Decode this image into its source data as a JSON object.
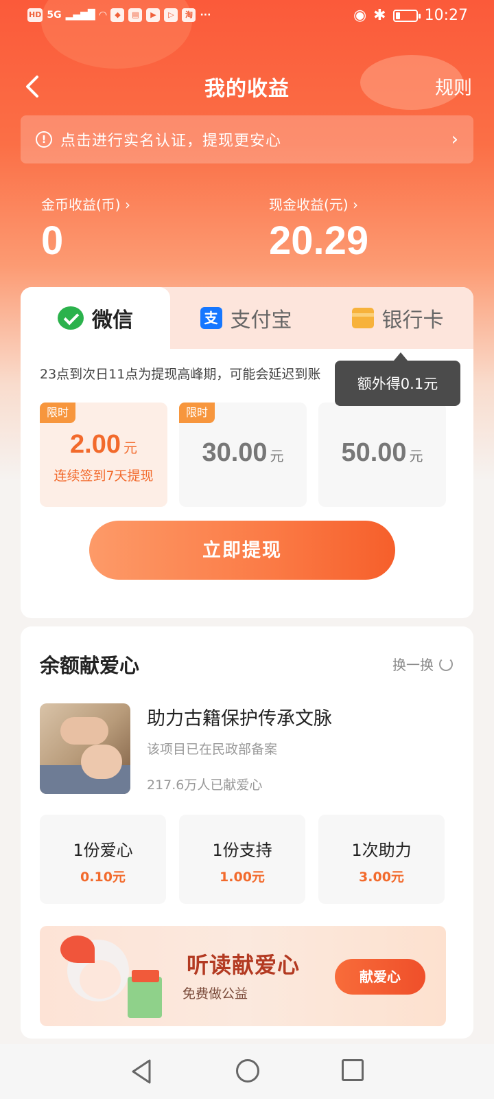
{
  "status_bar": {
    "time": "10:27",
    "network": "5G",
    "battery_level": 0.2
  },
  "header": {
    "title": "我的收益",
    "rules_label": "规则"
  },
  "verify_banner": {
    "text": "点击进行实名认证，提现更安心"
  },
  "earnings": {
    "coins_label": "金币收益(币) ›",
    "coins_value": "0",
    "cash_label": "现金收益(元) ›",
    "cash_value": "20.29"
  },
  "withdraw": {
    "tabs": [
      {
        "label": "微信",
        "icon": "wechat-icon",
        "active": true
      },
      {
        "label": "支付宝",
        "icon": "alipay-icon",
        "active": false
      },
      {
        "label": "银行卡",
        "icon": "bank-card-icon",
        "active": false
      }
    ],
    "peak_note": "23点到次日11点为提现高峰期，可能会延迟到账",
    "tooltip": "额外得0.1元",
    "amounts": [
      {
        "badge": "限时",
        "value": "2.00",
        "unit": "元",
        "sub": "连续签到7天提现",
        "selected": true
      },
      {
        "badge": "限时",
        "value": "30.00",
        "unit": "元",
        "sub": "",
        "selected": false
      },
      {
        "badge": "",
        "value": "50.00",
        "unit": "元",
        "sub": "",
        "selected": false
      }
    ],
    "button_label": "立即提现"
  },
  "donation": {
    "title": "余额献爱心",
    "refresh_label": "换一换",
    "project": {
      "name": "助力古籍保护传承文脉",
      "registration": "该项目已在民政部备案",
      "count": "217.6万人已献爱心"
    },
    "options": [
      {
        "label": "1份爱心",
        "price": "0.10元"
      },
      {
        "label": "1份支持",
        "price": "1.00元"
      },
      {
        "label": "1次助力",
        "price": "3.00元"
      }
    ],
    "banner": {
      "title": "听读献爱心",
      "subtitle": "免费做公益",
      "button": "献爱心"
    }
  },
  "colors": {
    "accent": "#f26a2c",
    "header_gradient_top": "#fb5a3a",
    "wechat_green": "#2bb24c",
    "alipay_blue": "#1677ff"
  }
}
